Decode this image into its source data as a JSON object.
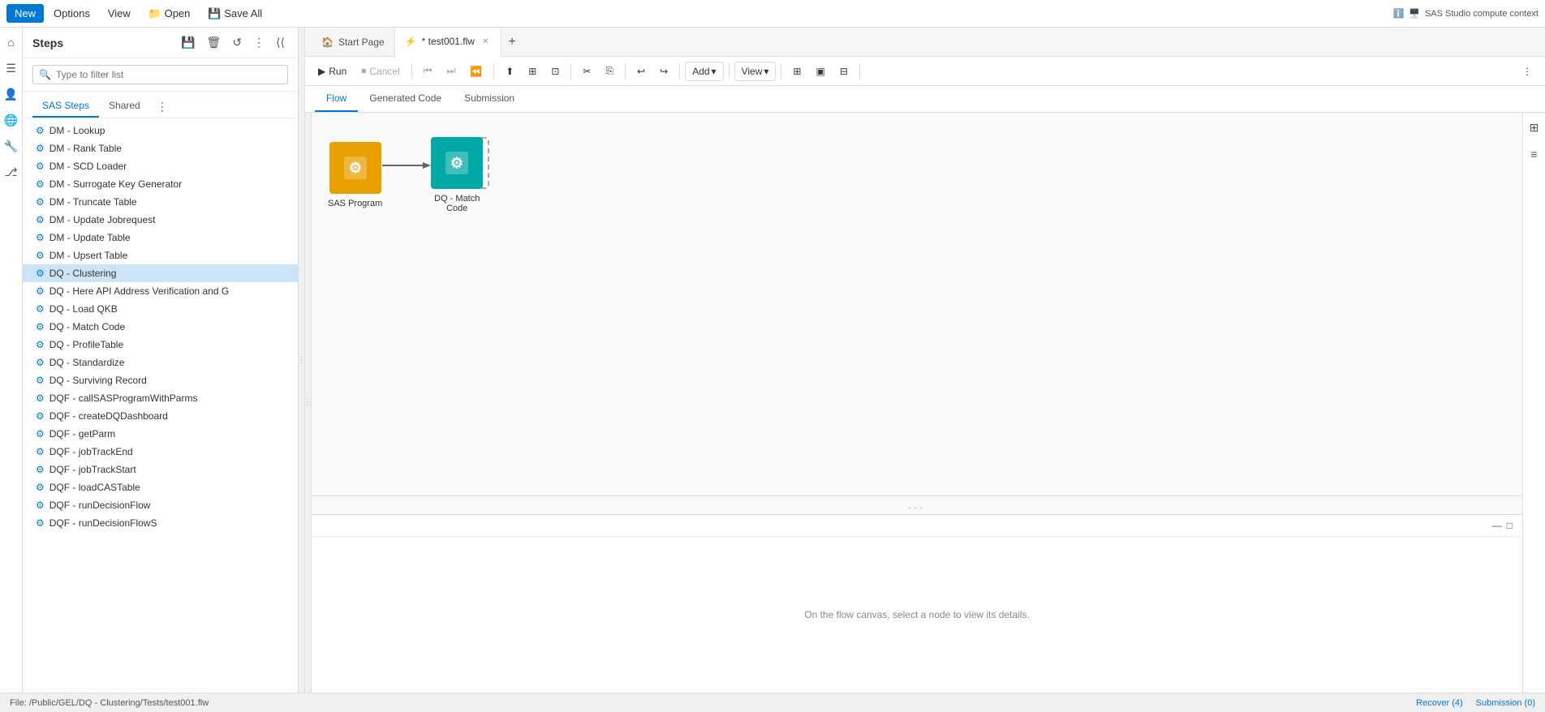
{
  "menubar": {
    "items": [
      {
        "label": "New",
        "active": true
      },
      {
        "label": "Options",
        "active": false
      },
      {
        "label": "View",
        "active": false
      },
      {
        "label": "Open",
        "active": false
      },
      {
        "label": "Save All",
        "active": false
      }
    ],
    "right_text": "SAS Studio compute context"
  },
  "iconbar_left": {
    "icons": [
      "home",
      "layers",
      "person",
      "globe",
      "tool",
      "git"
    ]
  },
  "steps_panel": {
    "title": "Steps",
    "icons": [
      "save",
      "delete",
      "refresh",
      "more"
    ],
    "search_placeholder": "Type to filter list",
    "tabs": [
      {
        "label": "SAS Steps",
        "active": true
      },
      {
        "label": "Shared",
        "active": false
      }
    ],
    "items": [
      {
        "label": "DM - Lookup",
        "selected": false
      },
      {
        "label": "DM - Rank Table",
        "selected": false
      },
      {
        "label": "DM - SCD Loader",
        "selected": false
      },
      {
        "label": "DM - Surrogate Key Generator",
        "selected": false
      },
      {
        "label": "DM - Truncate Table",
        "selected": false
      },
      {
        "label": "DM - Update Jobrequest",
        "selected": false
      },
      {
        "label": "DM - Update Table",
        "selected": false
      },
      {
        "label": "DM - Upsert Table",
        "selected": false
      },
      {
        "label": "DQ - Clustering",
        "selected": true
      },
      {
        "label": "DQ - Here API Address Verification and G",
        "selected": false
      },
      {
        "label": "DQ - Load QKB",
        "selected": false
      },
      {
        "label": "DQ - Match Code",
        "selected": false
      },
      {
        "label": "DQ - ProfileTable",
        "selected": false
      },
      {
        "label": "DQ - Standardize",
        "selected": false
      },
      {
        "label": "DQ - Surviving Record",
        "selected": false
      },
      {
        "label": "DQF - callSASProgramWithParms",
        "selected": false
      },
      {
        "label": "DQF - createDQDashboard",
        "selected": false
      },
      {
        "label": "DQF - getParm",
        "selected": false
      },
      {
        "label": "DQF - jobTrackEnd",
        "selected": false
      },
      {
        "label": "DQF - jobTrackStart",
        "selected": false
      },
      {
        "label": "DQF - loadCASTable",
        "selected": false
      },
      {
        "label": "DQF - runDecisionFlow",
        "selected": false
      },
      {
        "label": "DQF - runDecisionFlowS",
        "selected": false
      }
    ]
  },
  "tabs": [
    {
      "label": "Start Page",
      "active": false,
      "closeable": false,
      "icon": "🏠"
    },
    {
      "label": "* test001.flw",
      "active": true,
      "closeable": true,
      "icon": "⚡"
    }
  ],
  "toolbar": {
    "run_label": "Run",
    "cancel_label": "Cancel",
    "add_label": "Add",
    "view_label": "View",
    "buttons": [
      "run",
      "cancel",
      "sep",
      "back2",
      "forward",
      "back",
      "sep2",
      "upload",
      "grid",
      "grid2",
      "sep3",
      "cut",
      "copy",
      "sep4",
      "undo",
      "redo",
      "sep5",
      "add",
      "sep6",
      "view",
      "sep7",
      "layout1",
      "layout2",
      "layout3",
      "sep8",
      "more"
    ]
  },
  "inner_tabs": [
    {
      "label": "Flow",
      "active": true
    },
    {
      "label": "Generated Code",
      "active": false
    },
    {
      "label": "Submission",
      "active": false
    }
  ],
  "canvas": {
    "nodes": [
      {
        "id": "sas-program",
        "label": "SAS Program",
        "type": "sas-program",
        "color": "#e8a000",
        "icon": "⚙"
      },
      {
        "id": "dq-match-code",
        "label": "DQ - Match\nCode",
        "type": "dq-match",
        "color": "#00a9a5",
        "icon": "⚙"
      }
    ],
    "info_text": "On the flow canvas, select a node to view its details.",
    "divider_dots": "..."
  },
  "status_bar": {
    "file_path": "File: /Public/GEL/DQ - Clustering/Tests/test001.flw",
    "recover_label": "Recover (4)",
    "submission_label": "Submission (0)"
  },
  "colors": {
    "accent": "#0078d4",
    "selected_bg": "#cce4f7",
    "sas_node": "#e8a000",
    "dq_node": "#00a9a5"
  }
}
